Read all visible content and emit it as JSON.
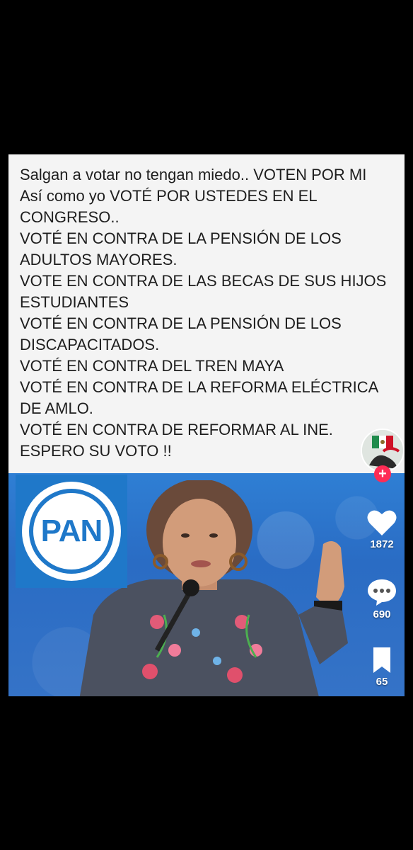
{
  "post": {
    "lines": [
      "Salgan a votar no tengan miedo.. VOTEN POR MI",
      "Así como yo VOTÉ POR USTEDES EN EL",
      "CONGRESO..",
      "VOTÉ EN CONTRA DE LA PENSIÓN DE LOS",
      "ADULTOS MAYORES.",
      "VOTE EN CONTRA DE LAS BECAS DE SUS HIJOS",
      "ESTUDIANTES",
      "VOTÉ EN CONTRA DE LA PENSIÓN DE LOS",
      "DISCAPACITADOS.",
      "VOTÉ EN CONTRA DEL TREN MAYA",
      "VOTÉ EN CONTRA DE LA REFORMA ELÉCTRICA",
      "DE AMLO.",
      "VOTÉ EN CONTRA DE REFORMAR AL  INE.",
      "ESPERO SU VOTO !!"
    ],
    "logo_text": "PAN"
  },
  "actions": {
    "follow_symbol": "+",
    "like_count": "1872",
    "comment_count": "690",
    "save_count": "65",
    "like_icon": "heart-icon",
    "comment_icon": "comment-bubble-icon",
    "save_icon": "bookmark-icon"
  },
  "colors": {
    "background": "#000000",
    "card": "#f4f4f4",
    "pan_blue": "#1f78c9",
    "follow_red": "#fe2c55"
  }
}
